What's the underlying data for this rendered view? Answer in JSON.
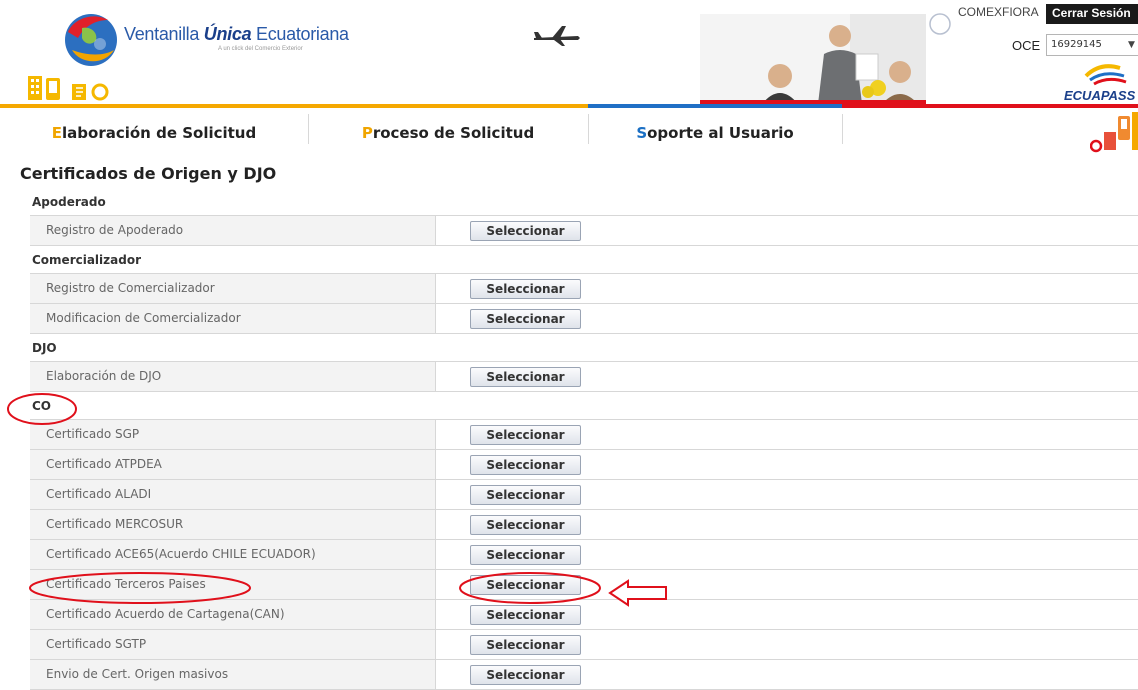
{
  "header": {
    "logo_prefix": "Ventanilla ",
    "logo_bold": "Única",
    "logo_suffix": " Ecuatoriana",
    "logo_subtitle": "A un click del Comercio Exterior",
    "user_name": "COMEXFIORA",
    "logout_label": "Cerrar Sesión",
    "oce_label": "OCE",
    "oce_value": "16929145",
    "brand_right_logo": "ECUAPASS"
  },
  "nav": {
    "items": [
      {
        "first_letter": "E",
        "rest": "laboración de Solicitud",
        "accent": "#f0a500"
      },
      {
        "first_letter": "P",
        "rest": "roceso de Solicitud",
        "accent": "#f0a500"
      },
      {
        "first_letter": "S",
        "rest": "oporte al Usuario",
        "accent": "#1a6fc4"
      }
    ],
    "bar_colors": [
      "#f5a800",
      "#f5a800",
      "#1f6fc6",
      "#e0101b"
    ]
  },
  "page": {
    "title": "Certificados de Origen y DJO",
    "button_label": "Seleccionar",
    "groups": [
      {
        "name": "Apoderado",
        "items": [
          "Registro de Apoderado"
        ]
      },
      {
        "name": "Comercializador",
        "items": [
          "Registro de Comercializador",
          "Modificacion de Comercializador"
        ]
      },
      {
        "name": "DJO",
        "items": [
          "Elaboración de DJO"
        ]
      },
      {
        "name": "CO",
        "items": [
          "Certificado SGP",
          "Certificado ATPDEA",
          "Certificado ALADI",
          "Certificado MERCOSUR",
          "Certificado ACE65(Acuerdo CHILE ECUADOR)",
          "Certificado Terceros Paises",
          "Certificado Acuerdo de Cartagena(CAN)",
          "Certificado SGTP",
          "Envio de Cert. Origen masivos"
        ]
      }
    ]
  },
  "colors": {
    "annotation": "#e0101b",
    "row_border": "#d7d7d7",
    "label_bg": "#f3f3f3"
  }
}
